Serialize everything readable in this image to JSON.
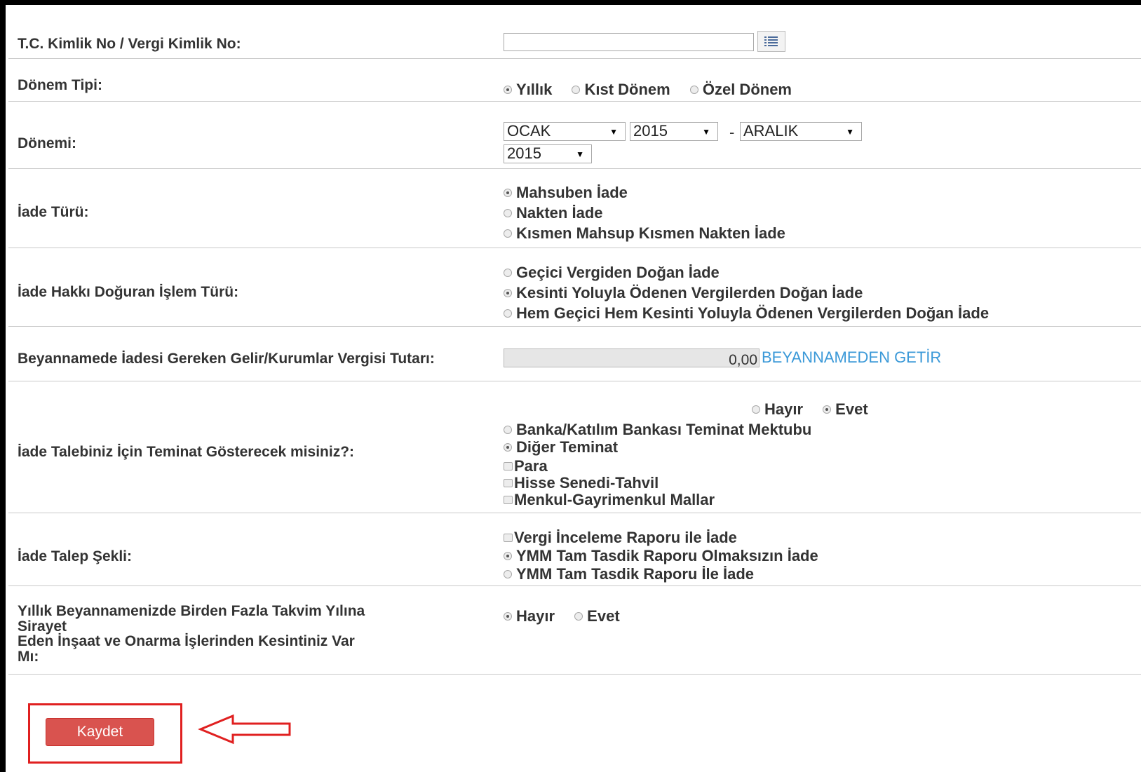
{
  "form": {
    "tc_label": "T.C. Kimlik No / Vergi Kimlik No:",
    "tc_value": "",
    "donem_tipi": {
      "label": "Dönem Tipi:",
      "options": [
        "Yıllık",
        "Kıst Dönem",
        "Özel Dönem"
      ],
      "selected": "Yıllık"
    },
    "donemi": {
      "label": "Dönemi:",
      "start_month": "OCAK",
      "start_year": "2015",
      "separator": "-",
      "end_month": "ARALIK",
      "end_year": "2015"
    },
    "iade_turu": {
      "label": "İade Türü:",
      "options": [
        "Mahsuben İade",
        "Nakten İade",
        "Kısmen Mahsup Kısmen Nakten İade"
      ],
      "selected": "Mahsuben İade"
    },
    "islem_turu": {
      "label": "İade Hakkı Doğuran İşlem Türü:",
      "options": [
        "Geçici Vergiden Doğan İade",
        "Kesinti Yoluyla Ödenen Vergilerden Doğan İade",
        "Hem Geçici Hem Kesinti Yoluyla Ödenen Vergilerden Doğan İade"
      ],
      "selected": "Kesinti Yoluyla Ödenen Vergilerden Doğan İade"
    },
    "tutar": {
      "label": "Beyannamede İadesi Gereken Gelir/Kurumlar Vergisi Tutarı:",
      "value": "0,00",
      "link": "BEYANNAMEDEN GETİR"
    },
    "teminat": {
      "label": "İade Talebiniz İçin Teminat Gösterecek misiniz?:",
      "yesno": [
        "Hayır",
        "Evet"
      ],
      "yesno_selected": "Evet",
      "types": [
        "Banka/Katılım Bankası Teminat Mektubu",
        "Diğer Teminat"
      ],
      "type_selected": "Diğer Teminat",
      "checks": [
        "Para",
        "Hisse Senedi-Tahvil",
        "Menkul-Gayrimenkul Mallar"
      ]
    },
    "talep_sekli": {
      "label": "İade Talep Şekli:",
      "check": "Vergi İnceleme Raporu ile İade",
      "options": [
        "YMM Tam Tasdik Raporu Olmaksızın İade",
        "YMM Tam Tasdik Raporu İle İade"
      ],
      "selected": "YMM Tam Tasdik Raporu Olmaksızın İade"
    },
    "insaat": {
      "label_lines": [
        "Yıllık Beyannamenizde Birden Fazla Takvim Yılına",
        "Sirayet",
        "Eden İnşaat ve Onarma İşlerinden Kesintiniz Var",
        "Mı:"
      ],
      "options": [
        "Hayır",
        "Evet"
      ],
      "selected": "Hayır"
    },
    "save_label": "Kaydet"
  },
  "colors": {
    "save_button": "#d9534f",
    "highlight_box": "#e02020",
    "link": "#3b99d8"
  },
  "icons": {
    "list": "list-icon",
    "arrow": "left-arrow-icon"
  }
}
